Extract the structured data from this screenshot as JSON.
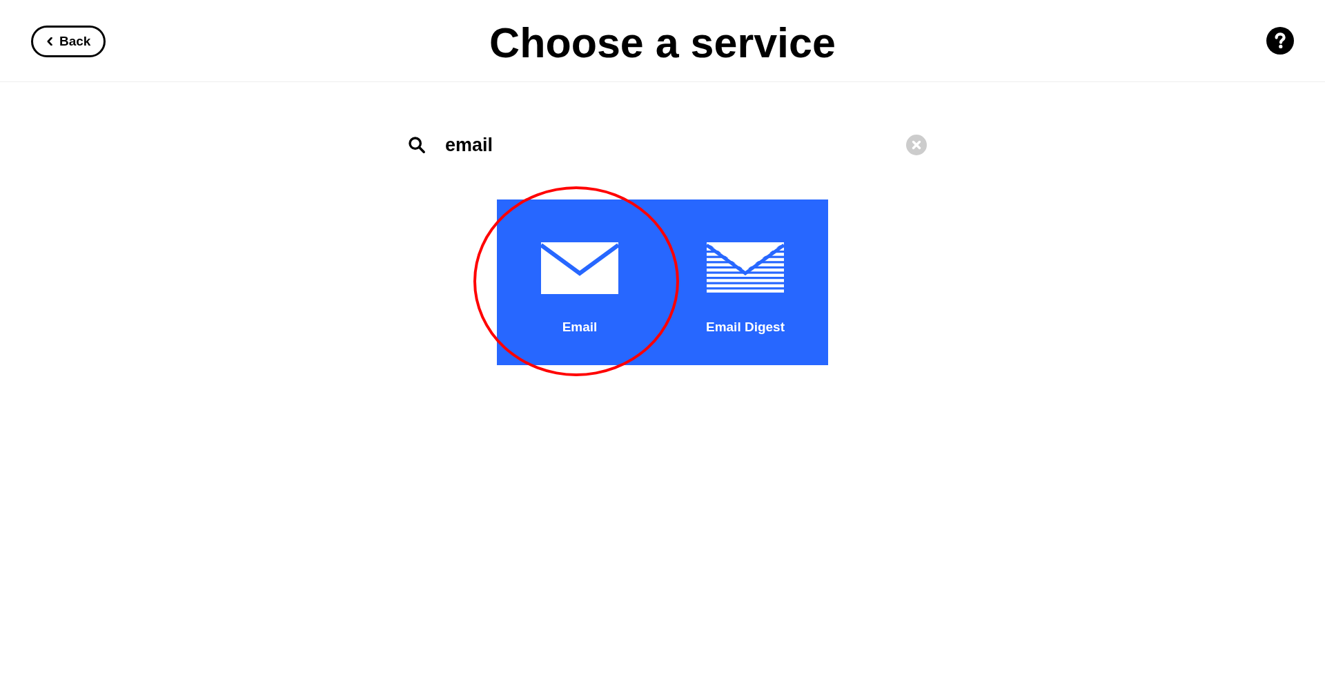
{
  "header": {
    "back_button": {
      "label": "Back"
    },
    "title": "Choose a service"
  },
  "search": {
    "value": "email"
  },
  "services": [
    {
      "name": "Email",
      "kind": "envelope",
      "circled": true
    },
    {
      "name": "Email Digest",
      "kind": "digest",
      "circled": false
    }
  ]
}
